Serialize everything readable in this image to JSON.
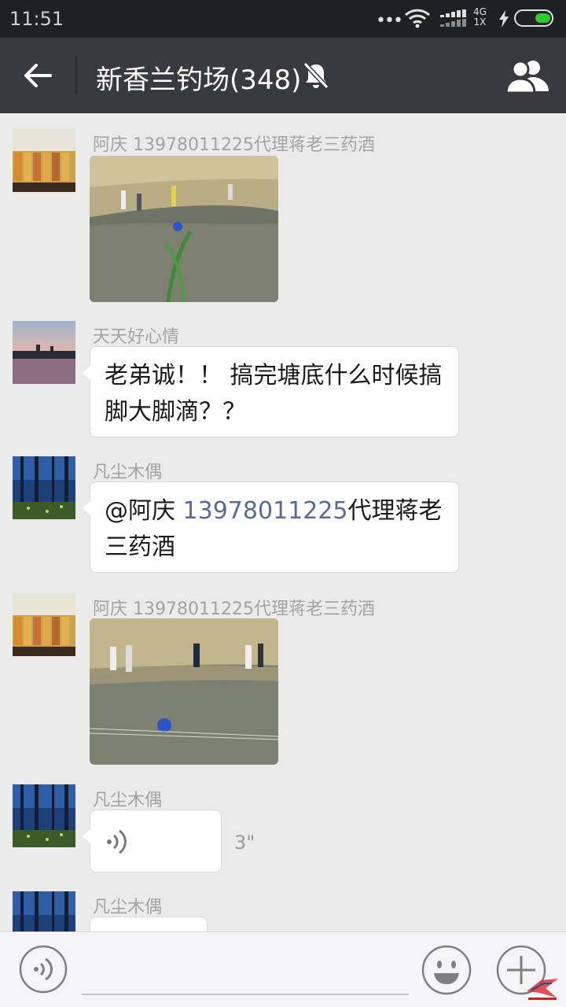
{
  "status_bar": {
    "time": "11:51",
    "network_type_top": "4G",
    "network_type_bottom": "1X",
    "battery_color": "#2ecc2e"
  },
  "header": {
    "title": "新香兰钓场(348)",
    "back_icon": "arrow-left-icon",
    "mute_icon": "bell-off-icon",
    "members_icon": "group-members-icon",
    "background": "#393a3f"
  },
  "messages": [
    {
      "sender": "阿庆   13978011225代理蒋老三药酒",
      "type": "image",
      "avatar": "bottles-avatar"
    },
    {
      "sender": "天天好心情",
      "type": "text",
      "text": "老弟诚！！ 搞完塘底什么时候搞脚大脚滴？？",
      "avatar": "city-sunset-avatar"
    },
    {
      "sender": "凡尘木偶",
      "type": "text",
      "mention": "@阿庆 ",
      "mention_number": "13978011225",
      "text": "代理蒋老三药酒",
      "avatar": "forest-avatar"
    },
    {
      "sender": "阿庆   13978011225代理蒋老三药酒",
      "type": "image",
      "avatar": "bottles-avatar"
    },
    {
      "sender": "凡尘木偶",
      "type": "voice",
      "duration": "3\"",
      "avatar": "forest-avatar"
    },
    {
      "sender": "凡尘木偶",
      "type": "voice",
      "avatar": "forest-avatar"
    }
  ],
  "input_bar": {
    "voice_icon": "voice-input-icon",
    "emoji_icon": "emoji-icon",
    "plus_icon": "plus-icon"
  },
  "colors": {
    "chat_background": "#ebebeb",
    "mention": "#576b95",
    "sender_name": "#a3a3a3"
  }
}
